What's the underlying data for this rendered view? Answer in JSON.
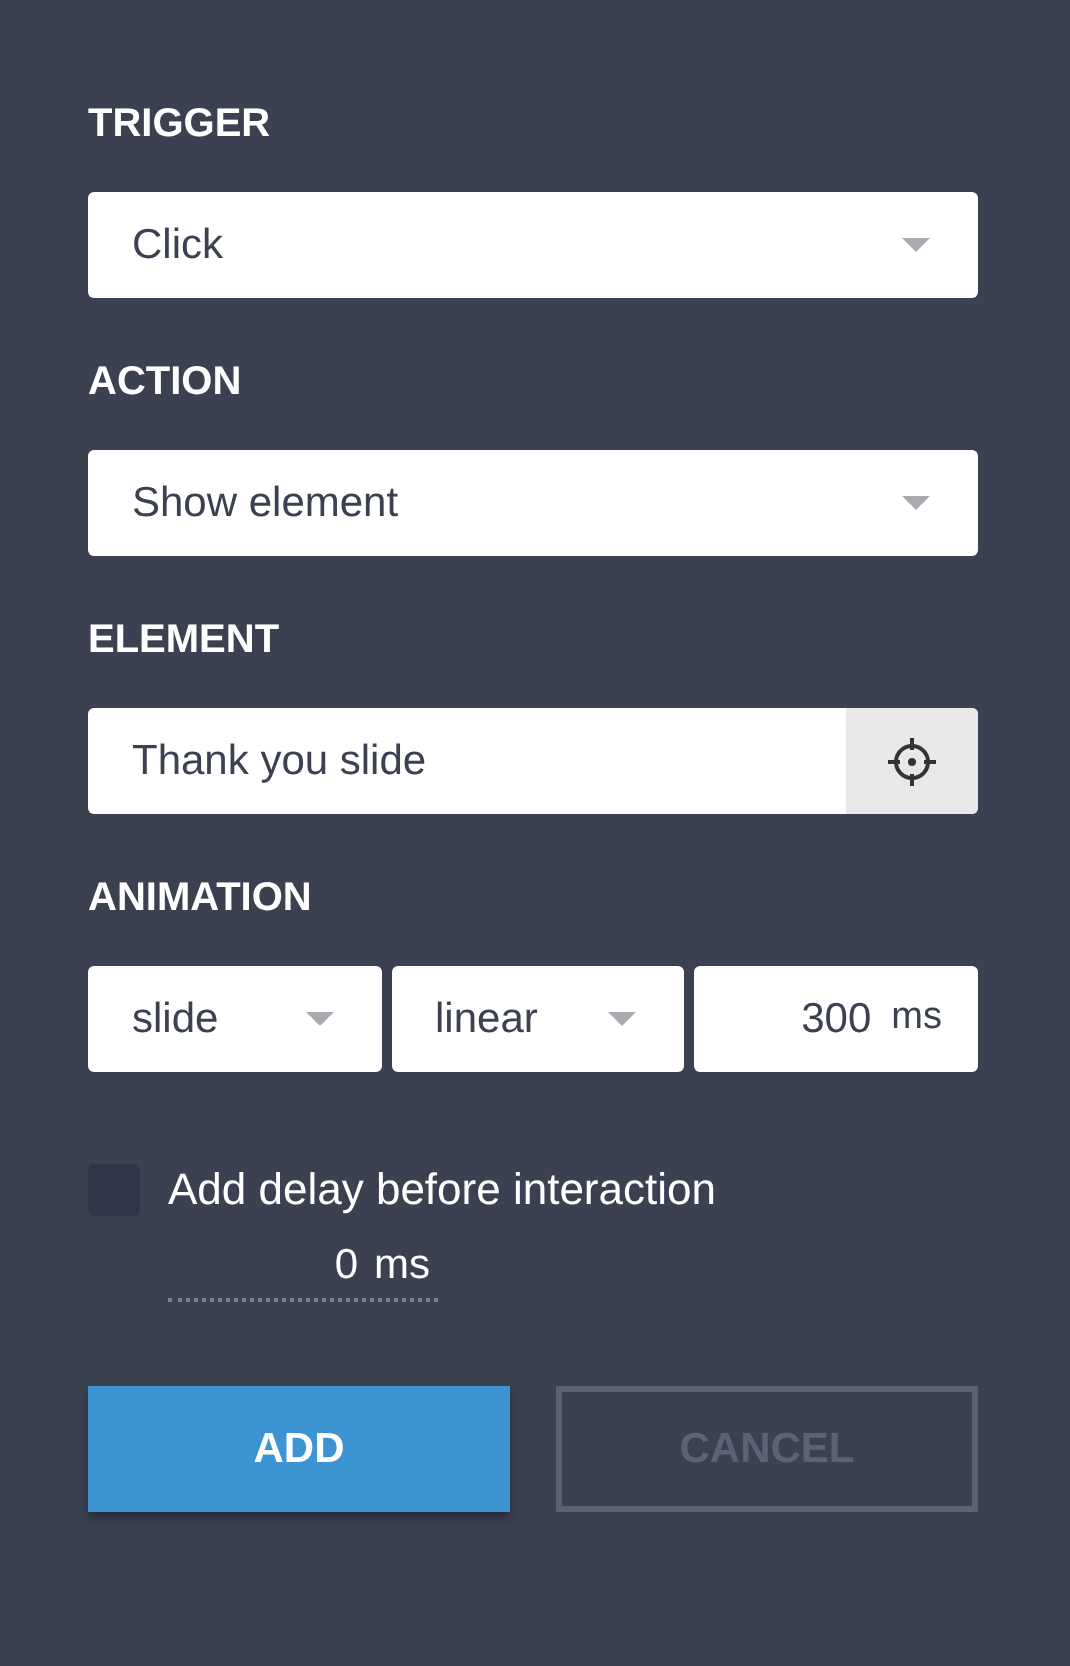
{
  "fields": [
    {
      "label": "TRIGGER",
      "inputs": [
        {
          "kind": "select",
          "value": "Click"
        }
      ]
    },
    {
      "label": "ACTION",
      "inputs": [
        {
          "kind": "select",
          "value": "Show element"
        }
      ]
    },
    {
      "label": "ELEMENT",
      "inputs": [
        {
          "kind": "picker",
          "value": "Thank you slide"
        }
      ]
    },
    {
      "label": "ANIMATION",
      "inputs": [
        {
          "kind": "select",
          "value": "slide"
        },
        {
          "kind": "select",
          "value": "linear"
        },
        {
          "kind": "number",
          "value": "300",
          "unit": "ms"
        }
      ]
    }
  ],
  "delay": {
    "checked": false,
    "label": "Add delay before interaction",
    "value": "0",
    "unit": "ms"
  },
  "buttons": [
    {
      "label": "ADD",
      "kind": "primary"
    },
    {
      "label": "CANCEL",
      "kind": "secondary"
    }
  ]
}
